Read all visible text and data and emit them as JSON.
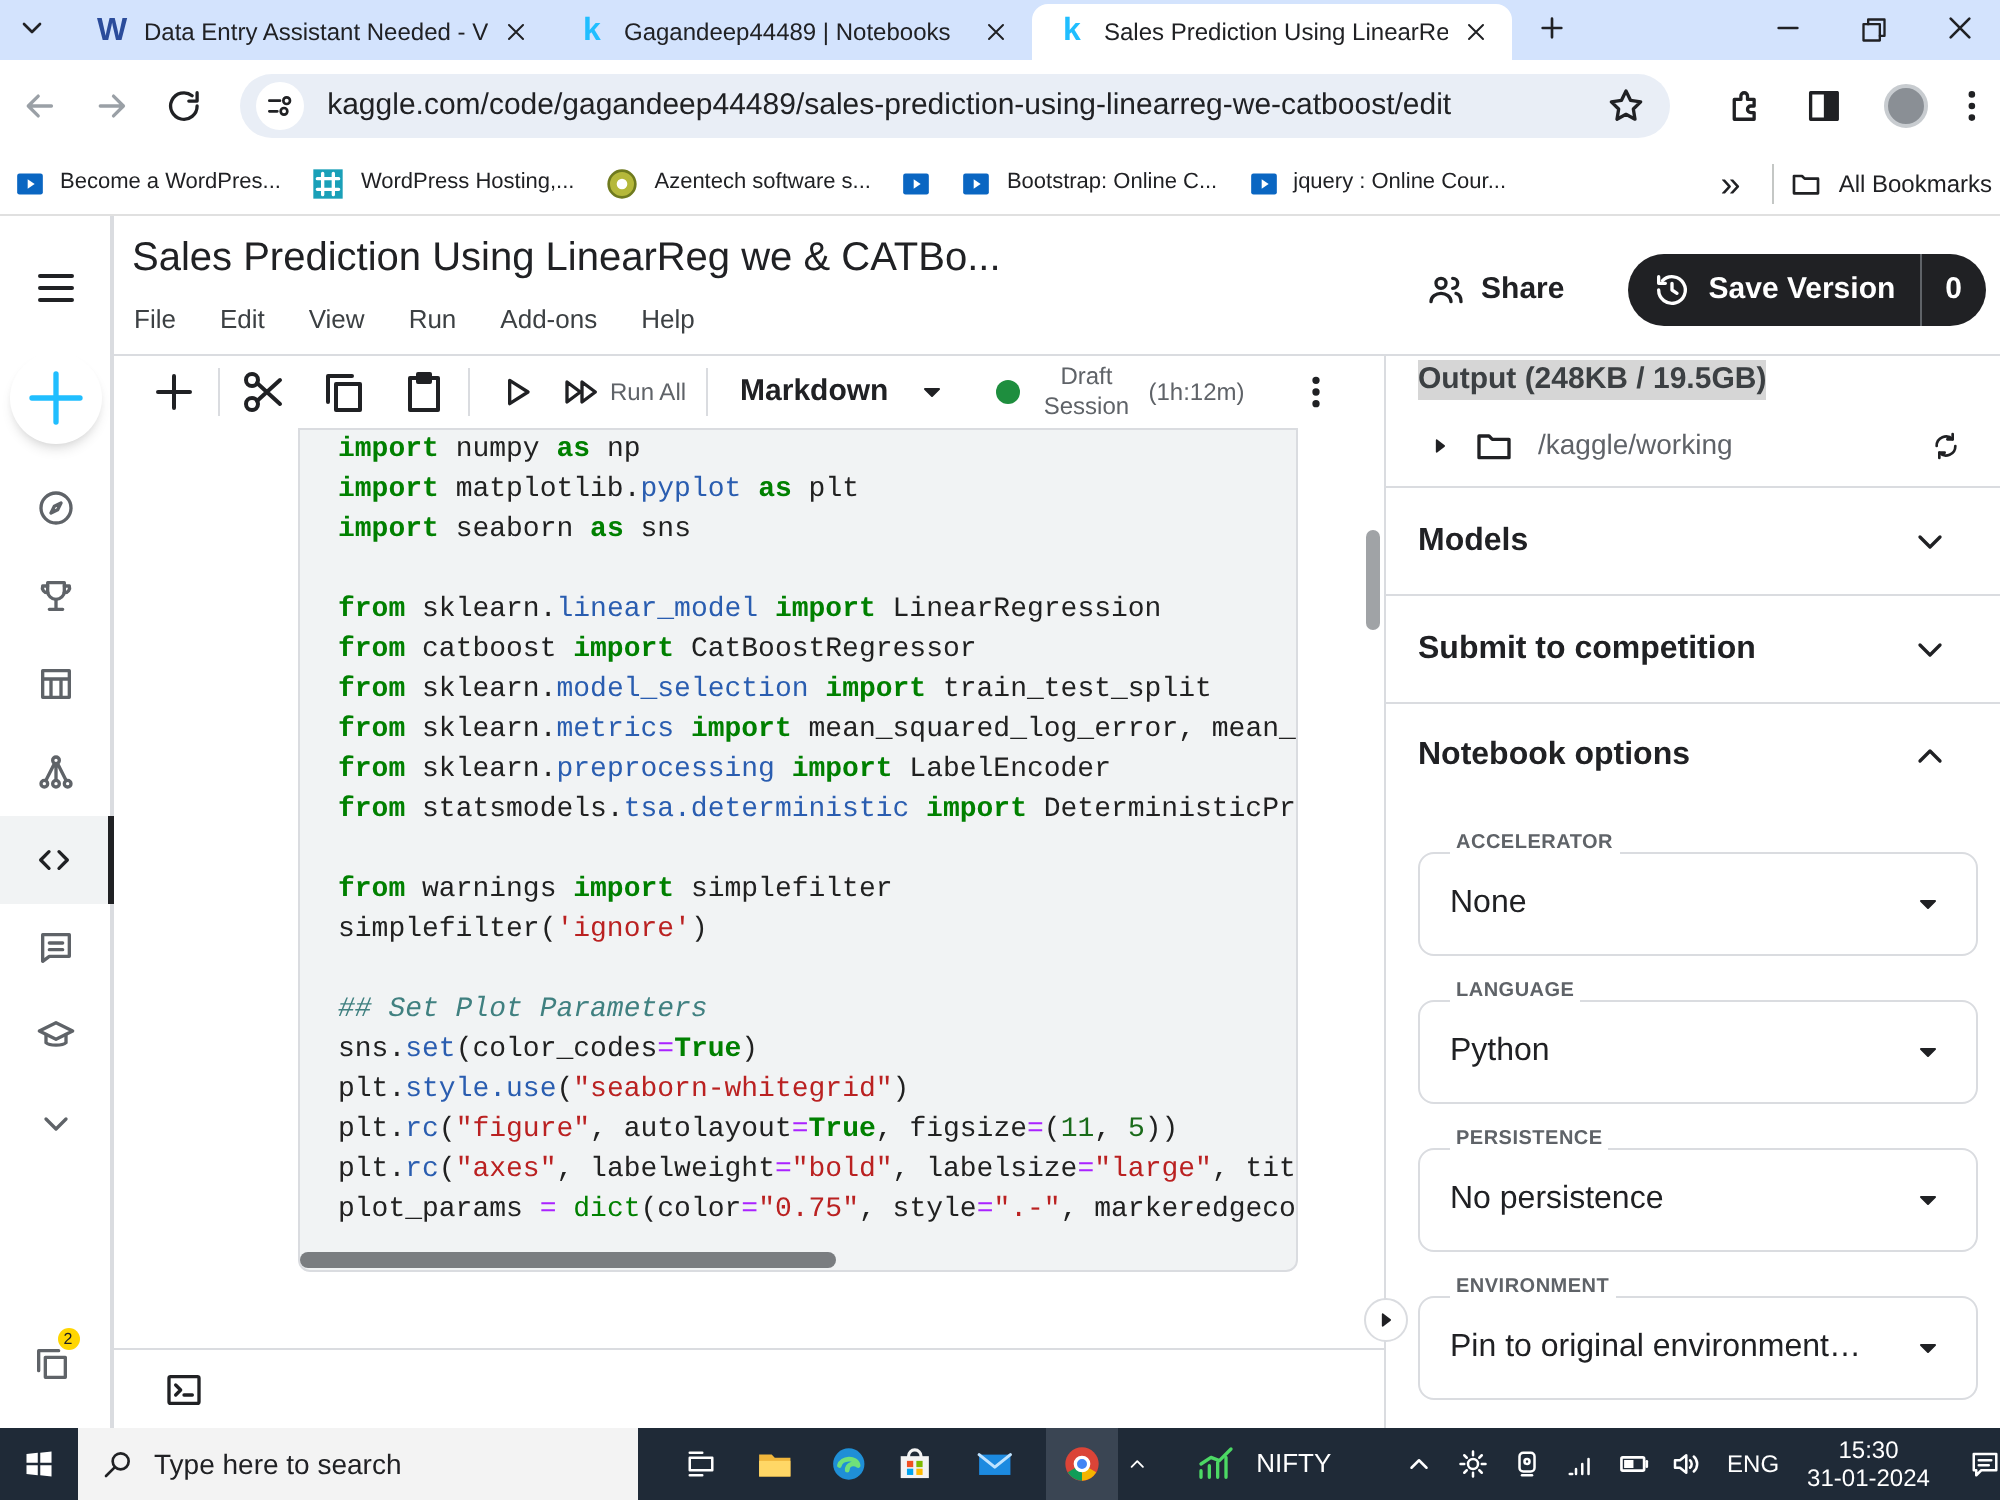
{
  "browser": {
    "tabs": [
      {
        "favicon": "W",
        "color": "#2b4c9b",
        "title": "Data Entry Assistant Needed - V",
        "selected": false
      },
      {
        "favicon": "k",
        "color": "#20beff",
        "title": "Gagandeep44489 | Notebooks",
        "selected": false
      },
      {
        "favicon": "k",
        "color": "#20beff",
        "title": "Sales Prediction Using LinearRe",
        "selected": true
      }
    ],
    "url": "kaggle.com/code/gagandeep44489/sales-prediction-using-linearreg-we-catboost/edit",
    "bookmarks": [
      {
        "kind": "video",
        "label": "Become a WordPres..."
      },
      {
        "kind": "grid",
        "label": "WordPress Hosting,..."
      },
      {
        "kind": "badge",
        "label": "Azentech software s..."
      },
      {
        "kind": "video"
      },
      {
        "kind": "video",
        "label": "Bootstrap: Online C..."
      },
      {
        "kind": "video",
        "label": "jquery : Online Cour..."
      }
    ],
    "overflow": "»",
    "all_bookmarks": "All Bookmarks"
  },
  "notebook": {
    "title": "Sales Prediction Using LinearReg we & CATBo...",
    "menu": [
      "File",
      "Edit",
      "View",
      "Run",
      "Add-ons",
      "Help"
    ],
    "share": "Share",
    "save_version": "Save Version",
    "version_count": "0",
    "rail": [
      {
        "kind": "create",
        "selected": false
      },
      {
        "kind": "nav",
        "selected": false
      },
      {
        "kind": "nav",
        "selected": false
      },
      {
        "kind": "nav",
        "selected": false
      },
      {
        "kind": "nav",
        "selected": false
      },
      {
        "kind": "nav",
        "selected": true
      },
      {
        "kind": "nav",
        "selected": false
      },
      {
        "kind": "nav",
        "selected": false
      },
      {
        "kind": "nav",
        "selected": false
      }
    ],
    "rail_bottom": {
      "badge": "2"
    },
    "toolbar": {
      "run_all": "Run All",
      "cell_type": "Markdown",
      "session": {
        "label": "Draft Session",
        "time": "(1h:12m)",
        "active": true
      }
    },
    "code_lines": [
      {
        "kind": "code",
        "tokens": [
          {
            "kind": "keyword",
            "text": "import"
          },
          {
            "kind": "plain",
            "text": " numpy "
          },
          {
            "kind": "keyword",
            "text": "as"
          },
          {
            "kind": "plain",
            "text": " np"
          }
        ]
      },
      {
        "kind": "code",
        "tokens": [
          {
            "kind": "keyword",
            "text": "import"
          },
          {
            "kind": "plain",
            "text": " matplotlib."
          },
          {
            "kind": "module",
            "text": "pyplot"
          },
          {
            "kind": "keyword",
            "text": " as"
          },
          {
            "kind": "plain",
            "text": " plt"
          }
        ]
      },
      {
        "kind": "code",
        "tokens": [
          {
            "kind": "keyword",
            "text": "import"
          },
          {
            "kind": "plain",
            "text": " seaborn "
          },
          {
            "kind": "keyword",
            "text": "as"
          },
          {
            "kind": "plain",
            "text": " sns"
          }
        ]
      },
      {
        "kind": "blank"
      },
      {
        "kind": "code",
        "tokens": [
          {
            "kind": "keyword",
            "text": "from"
          },
          {
            "kind": "plain",
            "text": " sklearn."
          },
          {
            "kind": "module",
            "text": "linear_model"
          },
          {
            "kind": "keyword",
            "text": " import"
          },
          {
            "kind": "plain",
            "text": " LinearRegression"
          }
        ]
      },
      {
        "kind": "code",
        "tokens": [
          {
            "kind": "keyword",
            "text": "from"
          },
          {
            "kind": "plain",
            "text": " catboost "
          },
          {
            "kind": "keyword",
            "text": "import"
          },
          {
            "kind": "plain",
            "text": " CatBoostRegressor"
          }
        ]
      },
      {
        "kind": "code",
        "tokens": [
          {
            "kind": "keyword",
            "text": "from"
          },
          {
            "kind": "plain",
            "text": " sklearn."
          },
          {
            "kind": "module",
            "text": "model_selection"
          },
          {
            "kind": "keyword",
            "text": " import"
          },
          {
            "kind": "plain",
            "text": " train_test_split"
          }
        ]
      },
      {
        "kind": "code",
        "tokens": [
          {
            "kind": "keyword",
            "text": "from"
          },
          {
            "kind": "plain",
            "text": " sklearn."
          },
          {
            "kind": "module",
            "text": "metrics"
          },
          {
            "kind": "keyword",
            "text": " import"
          },
          {
            "kind": "plain",
            "text": " mean_squared_log_error, mean_"
          }
        ]
      },
      {
        "kind": "code",
        "tokens": [
          {
            "kind": "keyword",
            "text": "from"
          },
          {
            "kind": "plain",
            "text": " sklearn."
          },
          {
            "kind": "module",
            "text": "preprocessing"
          },
          {
            "kind": "keyword",
            "text": " import"
          },
          {
            "kind": "plain",
            "text": " LabelEncoder"
          }
        ]
      },
      {
        "kind": "code",
        "tokens": [
          {
            "kind": "keyword",
            "text": "from"
          },
          {
            "kind": "plain",
            "text": " statsmodels."
          },
          {
            "kind": "module",
            "text": "tsa.deterministic"
          },
          {
            "kind": "keyword",
            "text": " import"
          },
          {
            "kind": "plain",
            "text": " DeterministicPr"
          }
        ]
      },
      {
        "kind": "blank"
      },
      {
        "kind": "code",
        "tokens": [
          {
            "kind": "keyword",
            "text": "from"
          },
          {
            "kind": "plain",
            "text": " warnings "
          },
          {
            "kind": "keyword",
            "text": "import"
          },
          {
            "kind": "plain",
            "text": " simplefilter"
          }
        ]
      },
      {
        "kind": "code",
        "tokens": [
          {
            "kind": "plain",
            "text": "simplefilter("
          },
          {
            "kind": "string",
            "text": "'ignore'"
          },
          {
            "kind": "plain",
            "text": ")"
          }
        ]
      },
      {
        "kind": "blank"
      },
      {
        "kind": "code",
        "tokens": [
          {
            "kind": "comment",
            "text": "## Set Plot Parameters"
          }
        ]
      },
      {
        "kind": "code",
        "tokens": [
          {
            "kind": "plain",
            "text": "sns."
          },
          {
            "kind": "module",
            "text": "set"
          },
          {
            "kind": "plain",
            "text": "(color_codes"
          },
          {
            "kind": "operator",
            "text": "="
          },
          {
            "kind": "keyword",
            "text": "True"
          },
          {
            "kind": "plain",
            "text": ")"
          }
        ]
      },
      {
        "kind": "code",
        "tokens": [
          {
            "kind": "plain",
            "text": "plt."
          },
          {
            "kind": "module",
            "text": "style.use"
          },
          {
            "kind": "plain",
            "text": "("
          },
          {
            "kind": "string",
            "text": "\"seaborn-whitegrid\""
          },
          {
            "kind": "plain",
            "text": ")"
          }
        ]
      },
      {
        "kind": "code",
        "tokens": [
          {
            "kind": "plain",
            "text": "plt."
          },
          {
            "kind": "module",
            "text": "rc"
          },
          {
            "kind": "plain",
            "text": "("
          },
          {
            "kind": "string",
            "text": "\"figure\""
          },
          {
            "kind": "plain",
            "text": ", autolayout"
          },
          {
            "kind": "operator",
            "text": "="
          },
          {
            "kind": "keyword",
            "text": "True"
          },
          {
            "kind": "plain",
            "text": ", figsize"
          },
          {
            "kind": "operator",
            "text": "="
          },
          {
            "kind": "plain",
            "text": "("
          },
          {
            "kind": "number",
            "text": "11"
          },
          {
            "kind": "plain",
            "text": ", "
          },
          {
            "kind": "number",
            "text": "5"
          },
          {
            "kind": "plain",
            "text": "))"
          }
        ]
      },
      {
        "kind": "code",
        "tokens": [
          {
            "kind": "plain",
            "text": "plt."
          },
          {
            "kind": "module",
            "text": "rc"
          },
          {
            "kind": "plain",
            "text": "("
          },
          {
            "kind": "string",
            "text": "\"axes\""
          },
          {
            "kind": "plain",
            "text": ", labelweight"
          },
          {
            "kind": "operator",
            "text": "="
          },
          {
            "kind": "string",
            "text": "\"bold\""
          },
          {
            "kind": "plain",
            "text": ", labelsize"
          },
          {
            "kind": "operator",
            "text": "="
          },
          {
            "kind": "string",
            "text": "\"large\""
          },
          {
            "kind": "plain",
            "text": ", tit"
          }
        ]
      },
      {
        "kind": "code",
        "tokens": [
          {
            "kind": "plain",
            "text": "plot_params "
          },
          {
            "kind": "operator",
            "text": "="
          },
          {
            "kind": "builtin",
            "text": " dict"
          },
          {
            "kind": "plain",
            "text": "(color"
          },
          {
            "kind": "operator",
            "text": "="
          },
          {
            "kind": "string",
            "text": "\"0.75\""
          },
          {
            "kind": "plain",
            "text": ", style"
          },
          {
            "kind": "operator",
            "text": "="
          },
          {
            "kind": "string",
            "text": "\".-\""
          },
          {
            "kind": "plain",
            "text": ", markeredgeco"
          }
        ]
      }
    ],
    "output": {
      "title": "Output (248KB / 19.5GB)",
      "folder": "/kaggle/working"
    },
    "sections": [
      {
        "title": "Models",
        "expanded": false
      },
      {
        "title": "Submit to competition",
        "expanded": false
      },
      {
        "title": "Notebook options",
        "expanded": true
      }
    ],
    "options": [
      {
        "label": "ACCELERATOR",
        "value": "None"
      },
      {
        "label": "LANGUAGE",
        "value": "Python"
      },
      {
        "label": "PERSISTENCE",
        "value": "No persistence"
      },
      {
        "label": "ENVIRONMENT",
        "value": "Pin to original environment…"
      }
    ]
  },
  "taskbar": {
    "search": {
      "placeholder": "Type here to search"
    },
    "ticker": "NIFTY",
    "language": "ENG",
    "time": "15:30",
    "date": "31-01-2024"
  }
}
